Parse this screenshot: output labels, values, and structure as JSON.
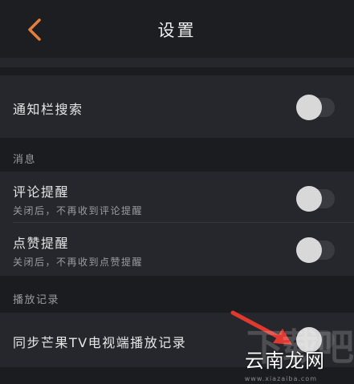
{
  "header": {
    "title": "设置"
  },
  "settings": {
    "notification_search": {
      "label": "通知栏搜索",
      "enabled": false
    },
    "section_messages": {
      "label": "消息"
    },
    "comment_reminder": {
      "label": "评论提醒",
      "description": "关闭后，不再收到评论提醒",
      "enabled": false
    },
    "like_reminder": {
      "label": "点赞提醒",
      "description": "关闭后，不再收到点赞提醒",
      "enabled": false
    },
    "section_history": {
      "label": "播放记录"
    },
    "sync_tv_history": {
      "label": "同步芒果TV电视端播放记录",
      "enabled": false
    }
  },
  "watermark": {
    "text": "云南龙网",
    "sub": "www.xiazaiba.com"
  },
  "colors": {
    "accent": "#e4803a",
    "background": "#1b1c20",
    "row": "#26272c",
    "annotation_arrow": "#e0392f"
  }
}
